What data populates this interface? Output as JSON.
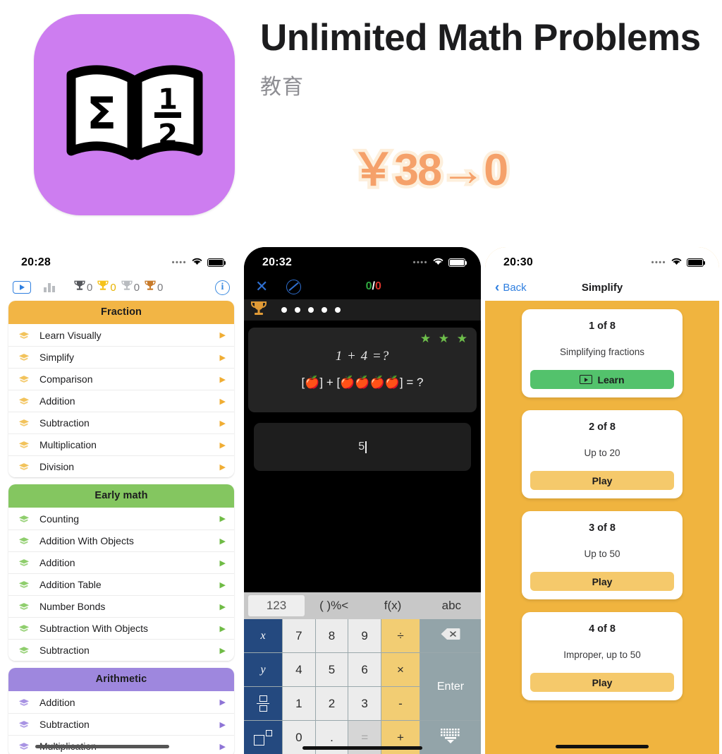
{
  "header": {
    "app_title": "Unlimited Math Problems",
    "category": "教育",
    "price_badge": "￥38→0",
    "icon_name": "book-sigma-fraction-icon",
    "icon_bg": "#cd7df0",
    "icon_sigma": "Σ",
    "icon_num": "1",
    "icon_den": "2"
  },
  "left_phone": {
    "status": {
      "clock": "20:28",
      "dots": "••••"
    },
    "toolbar": {
      "play_label": "play-button",
      "stats_label": "stats-button",
      "info_label": "i",
      "trophies": [
        {
          "color": "#55575c",
          "count": "0"
        },
        {
          "color": "#f5c21b",
          "count": "0"
        },
        {
          "color": "#b9bcc0",
          "count": "0"
        },
        {
          "color": "#c87a2a",
          "count": "0"
        }
      ]
    },
    "sections": [
      {
        "title": "Fraction",
        "header_color": "#f2b545",
        "cap_color": "#f2c35c",
        "arrow_color": "#f0ad33",
        "items": [
          "Learn Visually",
          "Simplify",
          "Comparison",
          "Addition",
          "Subtraction",
          "Multiplication",
          "Division"
        ]
      },
      {
        "title": "Early math",
        "header_color": "#84c660",
        "cap_color": "#8fce6d",
        "arrow_color": "#6fbb45",
        "items": [
          "Counting",
          "Addition With Objects",
          "Addition",
          "Addition Table",
          "Number Bonds",
          "Subtraction With Objects",
          "Subtraction"
        ]
      },
      {
        "title": "Arithmetic",
        "header_color": "#9e87de",
        "cap_color": "#a893e3",
        "arrow_color": "#8e74d6",
        "items": [
          "Addition",
          "Subtraction",
          "Multiplication"
        ]
      }
    ]
  },
  "mid_phone": {
    "status": {
      "clock": "20:32",
      "dots": "••••"
    },
    "topbar": {
      "close_label": "✕",
      "skip_label": "skip-icon",
      "correct": "0",
      "separator": "/",
      "wrong": "0"
    },
    "progress": {
      "trophy": "trophy-icon",
      "dots": 5
    },
    "problem": {
      "stars": "★ ★ ★",
      "equation": "1 + 4 =?",
      "visual": "[🍎] + [🍎🍎🍎🍎] = ?"
    },
    "answer": {
      "value": "5"
    },
    "keyboard": {
      "tabs": [
        "123",
        "( )%<",
        "f(x)",
        "abc"
      ],
      "active_tab": "123",
      "rows": [
        [
          {
            "label": "x",
            "type": "fn",
            "name": "key-variable-x"
          },
          {
            "label": "7",
            "type": "num",
            "name": "key-7"
          },
          {
            "label": "8",
            "type": "num",
            "name": "key-8"
          },
          {
            "label": "9",
            "type": "num",
            "name": "key-9"
          },
          {
            "label": "÷",
            "type": "op",
            "name": "key-divide"
          },
          {
            "label": "",
            "type": "util",
            "name": "key-backspace"
          }
        ],
        [
          {
            "label": "y",
            "type": "fn",
            "name": "key-variable-y"
          },
          {
            "label": "4",
            "type": "num",
            "name": "key-4"
          },
          {
            "label": "5",
            "type": "num",
            "name": "key-5"
          },
          {
            "label": "6",
            "type": "num",
            "name": "key-6"
          },
          {
            "label": "×",
            "type": "op",
            "name": "key-multiply"
          },
          {
            "label": "Enter",
            "type": "util",
            "name": "key-enter"
          }
        ],
        [
          {
            "label": "",
            "type": "fn",
            "name": "key-fraction"
          },
          {
            "label": "1",
            "type": "num",
            "name": "key-1"
          },
          {
            "label": "2",
            "type": "num",
            "name": "key-2"
          },
          {
            "label": "3",
            "type": "num",
            "name": "key-3"
          },
          {
            "label": "-",
            "type": "op",
            "name": "key-minus"
          }
        ],
        [
          {
            "label": "",
            "type": "fn",
            "name": "key-power"
          },
          {
            "label": "0",
            "type": "num",
            "name": "key-0"
          },
          {
            "label": ".",
            "type": "num",
            "name": "key-decimal"
          },
          {
            "label": "=",
            "type": "dim",
            "name": "key-equals"
          },
          {
            "label": "+",
            "type": "op",
            "name": "key-plus"
          },
          {
            "label": "",
            "type": "util",
            "name": "key-dismiss-keyboard"
          }
        ]
      ]
    }
  },
  "right_phone": {
    "status": {
      "clock": "20:30",
      "dots": "••••"
    },
    "nav": {
      "back_label": "Back",
      "title": "Simplify"
    },
    "bg_color": "#f0b43f",
    "levels": [
      {
        "num": "1 of 8",
        "desc": "Simplifying fractions",
        "button": "Learn",
        "button_kind": "learn"
      },
      {
        "num": "2 of 8",
        "desc": "Up to 20",
        "button": "Play",
        "button_kind": "play"
      },
      {
        "num": "3 of 8",
        "desc": "Up to 50",
        "button": "Play",
        "button_kind": "play"
      },
      {
        "num": "4 of 8",
        "desc": "Improper, up to 50",
        "button": "Play",
        "button_kind": "play"
      }
    ]
  }
}
